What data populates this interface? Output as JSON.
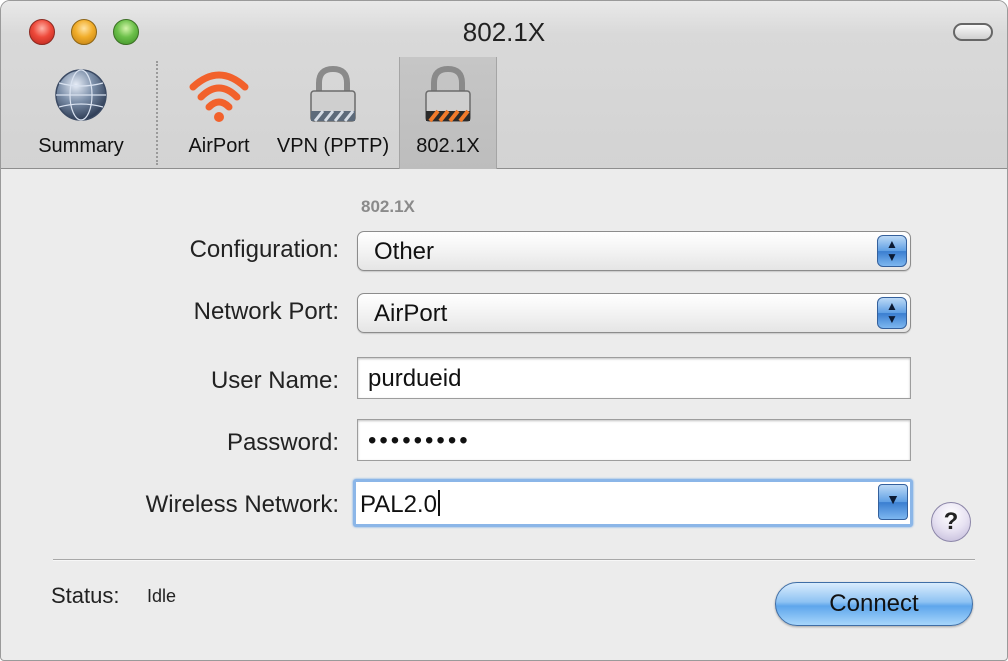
{
  "window": {
    "title": "802.1X"
  },
  "toolbar": {
    "items": [
      {
        "label": "Summary",
        "icon": "globe-icon"
      },
      {
        "label": "AirPort",
        "icon": "wifi-icon"
      },
      {
        "label": "VPN (PPTP)",
        "icon": "lock-icon"
      },
      {
        "label": "802.1X",
        "icon": "lock-striped-icon",
        "selected": true
      }
    ]
  },
  "section": {
    "title": "802.1X"
  },
  "form": {
    "configuration": {
      "label": "Configuration:",
      "value": "Other"
    },
    "network_port": {
      "label": "Network Port:",
      "value": "AirPort"
    },
    "user_name": {
      "label": "User Name:",
      "value": "purdueid"
    },
    "password": {
      "label": "Password:",
      "value": "•••••••••"
    },
    "wireless_network": {
      "label": "Wireless Network:",
      "value": "PAL2.0"
    }
  },
  "help": {
    "glyph": "?"
  },
  "status": {
    "label": "Status:",
    "value": "Idle"
  },
  "actions": {
    "connect": "Connect"
  },
  "colors": {
    "accent": "#5ea6ec",
    "selected_tab": "#c2c2c2"
  }
}
